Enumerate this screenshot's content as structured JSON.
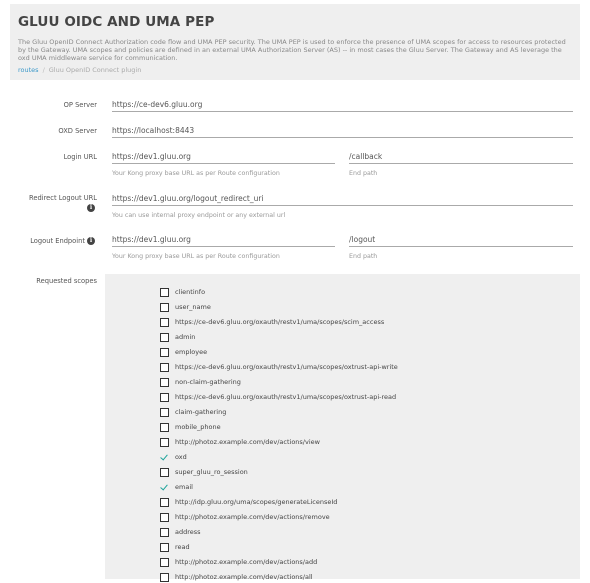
{
  "header": {
    "title": "GLUU OIDC AND UMA PEP",
    "description": "The Gluu OpenID Connect Authorization code flow and UMA PEP security. The UMA PEP is used to enforce the presence of UMA scopes for access to resources protected by the Gateway. UMA scopes and policies are defined in an external UMA Authorization Server (AS) -- in most cases the Gluu Server. The Gateway and AS leverage the oxd UMA middleware service for communication.",
    "breadcrumb": [
      "routes",
      "Gluu OpenID Connect plugin"
    ]
  },
  "form": {
    "op_server": {
      "label": "OP Server",
      "value": "https://ce-dev6.gluu.org"
    },
    "oxd_server": {
      "label": "OXD Server",
      "value": "https://localhost:8443"
    },
    "login_url": {
      "label": "Login URL",
      "value": "https://dev1.gluu.org",
      "help": "Your Kong proxy base URL as per Route configuration",
      "path": "/callback",
      "path_help": "End path"
    },
    "redirect_logout_url": {
      "label": "Redirect Logout URL",
      "value": "https://dev1.gluu.org/logout_redirect_uri",
      "help": "You can use internal proxy endpoint or any external url"
    },
    "logout_endpoint": {
      "label": "Logout Endpoint",
      "value": "https://dev1.gluu.org",
      "help": "Your Kong proxy base URL as per Route configuration",
      "path": "/logout",
      "path_help": "End path"
    },
    "requested_scopes_label": "Requested scopes",
    "info_glyph": "i"
  },
  "scopes": [
    {
      "label": "clientinfo",
      "checked": false
    },
    {
      "label": "user_name",
      "checked": false
    },
    {
      "label": "https://ce-dev6.gluu.org/oxauth/restv1/uma/scopes/scim_access",
      "checked": false
    },
    {
      "label": "admin",
      "checked": false
    },
    {
      "label": "employee",
      "checked": false
    },
    {
      "label": "https://ce-dev6.gluu.org/oxauth/restv1/uma/scopes/oxtrust-api-write",
      "checked": false
    },
    {
      "label": "non-claim-gathering",
      "checked": false
    },
    {
      "label": "https://ce-dev6.gluu.org/oxauth/restv1/uma/scopes/oxtrust-api-read",
      "checked": false
    },
    {
      "label": "claim-gathering",
      "checked": false
    },
    {
      "label": "mobile_phone",
      "checked": false
    },
    {
      "label": "http://photoz.example.com/dev/actions/view",
      "checked": false
    },
    {
      "label": "oxd",
      "checked": true
    },
    {
      "label": "super_gluu_ro_session",
      "checked": false
    },
    {
      "label": "email",
      "checked": true
    },
    {
      "label": "http://idp.gluu.org/uma/scopes/generateLicenseId",
      "checked": false
    },
    {
      "label": "http://photoz.example.com/dev/actions/remove",
      "checked": false
    },
    {
      "label": "address",
      "checked": false
    },
    {
      "label": "read",
      "checked": false
    },
    {
      "label": "http://photoz.example.com/dev/actions/add",
      "checked": false
    },
    {
      "label": "http://photoz.example.com/dev/actions/all",
      "checked": false
    }
  ],
  "colors": {
    "accent": "#3a98c9",
    "check": "#1aa39a",
    "panel": "#efefef"
  }
}
